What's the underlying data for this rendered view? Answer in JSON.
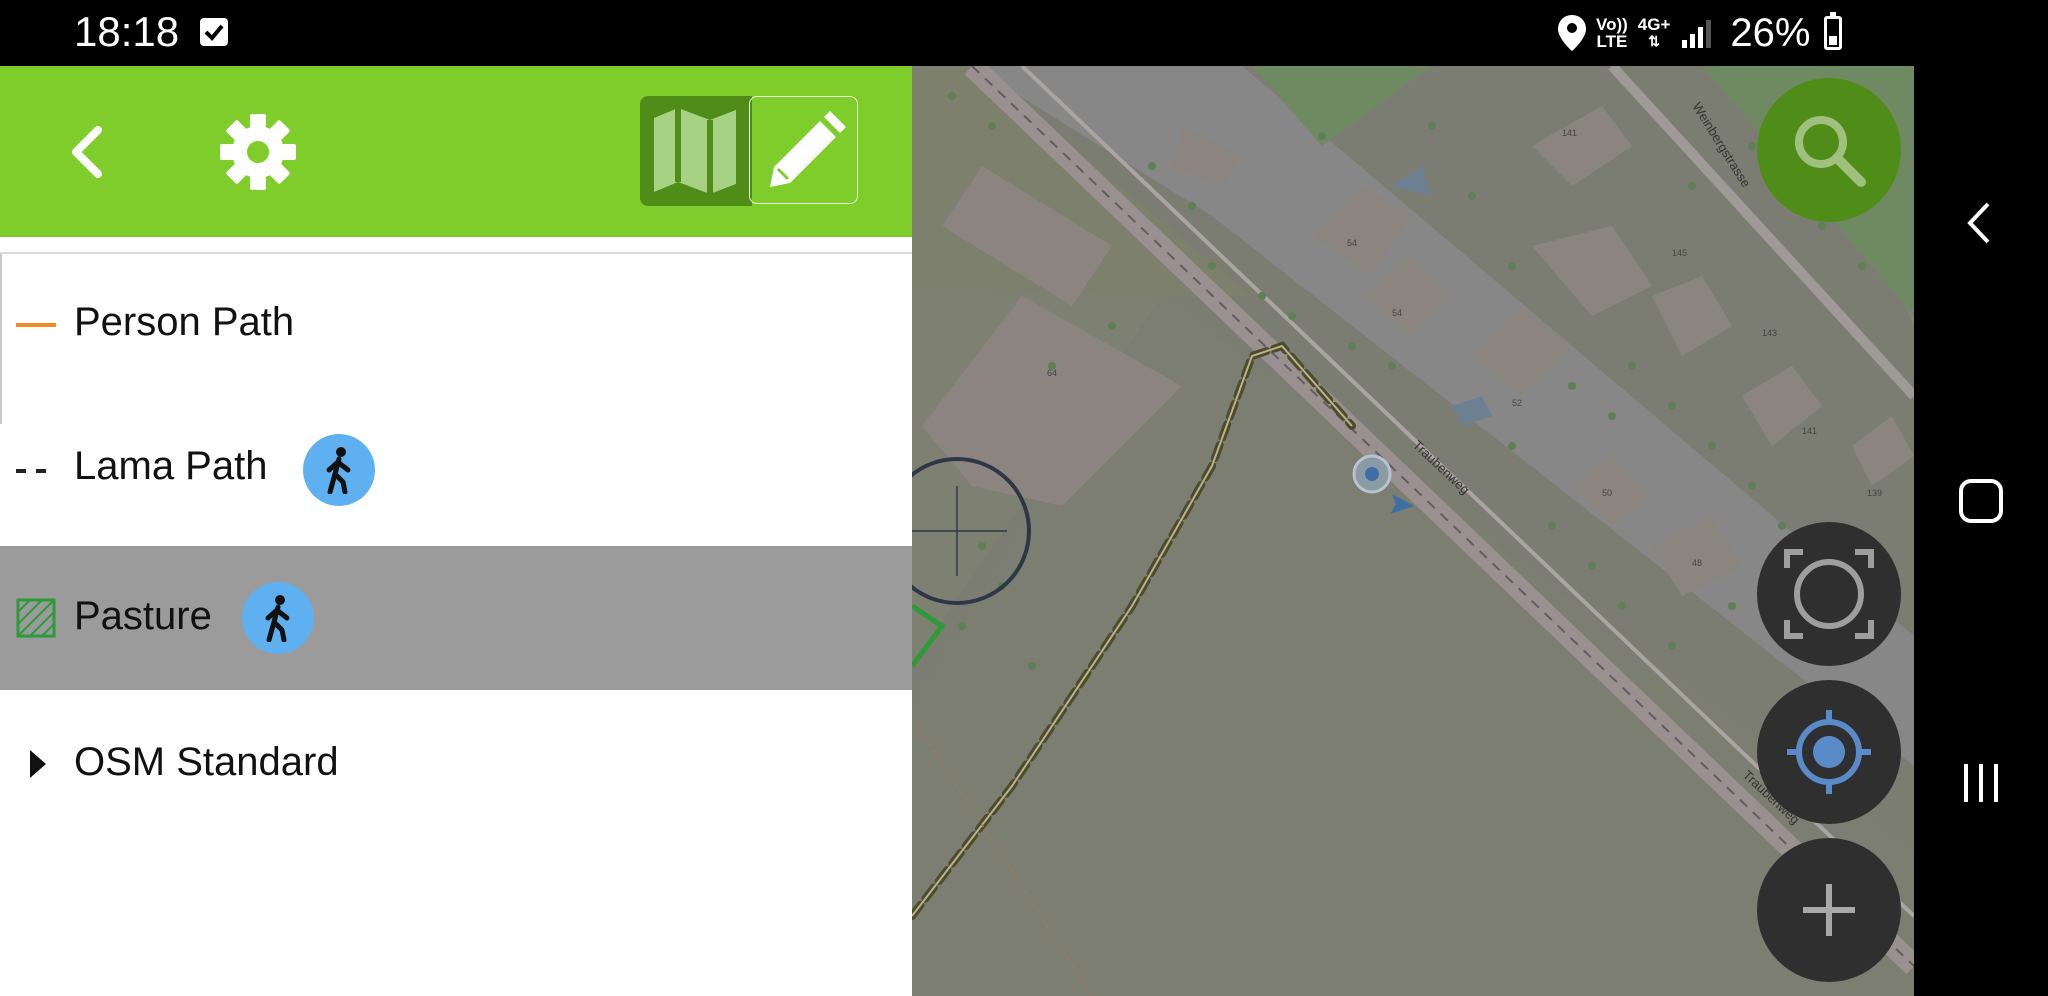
{
  "status_bar": {
    "time": "18:18",
    "network_volte_top": "Vo))",
    "network_volte_bottom": "LTE",
    "network_type": "4G+",
    "battery_percent": "26%",
    "battery_level": 0.26
  },
  "toolbar": {
    "back_icon": "chevron-left-icon",
    "settings_icon": "gear-icon",
    "map_mode_icon": "map-icon",
    "edit_mode_icon": "pencil-icon",
    "color": "#7ecd2a"
  },
  "layers": [
    {
      "label": "Person Path",
      "indicator": "orange-line",
      "indicator_color": "#f08a24",
      "has_mode_badge": false,
      "selected": false
    },
    {
      "label": "Lama Path",
      "indicator": "dashed-line",
      "indicator_color": "#222222",
      "has_mode_badge": true,
      "mode_icon": "walking-person-icon",
      "selected": false
    },
    {
      "label": "Pasture",
      "indicator": "hatched-square",
      "indicator_color": "#2e9a3a",
      "has_mode_badge": true,
      "mode_icon": "walking-person-icon",
      "selected": true
    },
    {
      "label": "OSM Standard",
      "indicator": "expand-triangle",
      "indicator_color": "#111111",
      "has_mode_badge": false,
      "selected": false
    }
  ],
  "map": {
    "street_label_1": "Traubenweg",
    "street_label_2": "Traubenweg",
    "street_label_3": "Weinbergstrasse",
    "building_numbers": [
      "141",
      "145",
      "143",
      "54",
      "54",
      "52",
      "141",
      "139",
      "50",
      "48",
      "64"
    ]
  },
  "map_controls": {
    "search_icon": "search-icon",
    "zoom_fit_icon": "zoom-fit-icon",
    "locate_icon": "gps-locate-icon",
    "add_icon": "plus-icon"
  },
  "nav_bar": {
    "back_icon": "nav-back-icon",
    "home_icon": "nav-home-icon",
    "recents_icon": "nav-recents-icon"
  }
}
